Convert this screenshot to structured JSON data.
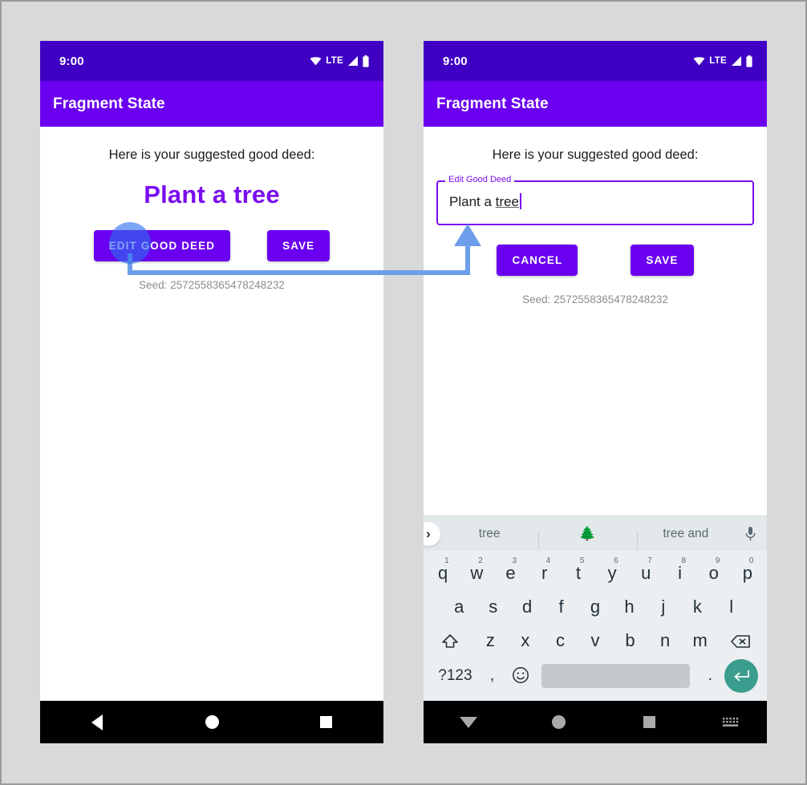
{
  "background_color": "#d9d9d9",
  "accent_purple": "#6a00ef",
  "annotation_color": "#6d9eeb",
  "phones": [
    {
      "id": "left",
      "status_bar": {
        "clock": "9:00",
        "network_label": "LTE",
        "icons": [
          "wifi-icon",
          "signal-icon",
          "battery-icon"
        ]
      },
      "app_bar": {
        "title": "Fragment State"
      },
      "content": {
        "prompt": "Here is your suggested good deed:",
        "deed_text": "Plant a tree",
        "buttons": [
          {
            "label": "EDIT GOOD DEED",
            "name": "edit-good-deed-button"
          },
          {
            "label": "SAVE",
            "name": "save-button"
          }
        ],
        "seed": "Seed: 2572558365478248232"
      },
      "nav_bar": {
        "back": "back-triangle-icon",
        "home": "home-circle-icon",
        "recents": "recents-square-icon"
      }
    },
    {
      "id": "right",
      "status_bar": {
        "clock": "9:00",
        "network_label": "LTE",
        "icons": [
          "wifi-icon",
          "signal-icon",
          "battery-icon"
        ]
      },
      "app_bar": {
        "title": "Fragment State"
      },
      "content": {
        "prompt": "Here is your suggested good deed:",
        "text_field": {
          "label": "Edit Good Deed",
          "value_prefix": "Plant a ",
          "value_underlined": "tree"
        },
        "buttons": [
          {
            "label": "CANCEL",
            "name": "cancel-button"
          },
          {
            "label": "SAVE",
            "name": "save-button"
          }
        ],
        "seed": "Seed: 2572558365478248232"
      },
      "keyboard": {
        "suggestions": {
          "expand_icon": "chevron-right-icon",
          "items": [
            "tree",
            "🌲",
            "tree and"
          ],
          "mic_icon": "microphone-icon"
        },
        "row1": [
          {
            "key": "q",
            "num": "1"
          },
          {
            "key": "w",
            "num": "2"
          },
          {
            "key": "e",
            "num": "3"
          },
          {
            "key": "r",
            "num": "4"
          },
          {
            "key": "t",
            "num": "5"
          },
          {
            "key": "y",
            "num": "6"
          },
          {
            "key": "u",
            "num": "7"
          },
          {
            "key": "i",
            "num": "8"
          },
          {
            "key": "o",
            "num": "9"
          },
          {
            "key": "p",
            "num": "0"
          }
        ],
        "row2": [
          "a",
          "s",
          "d",
          "f",
          "g",
          "h",
          "j",
          "k",
          "l"
        ],
        "row3": [
          "z",
          "x",
          "c",
          "v",
          "b",
          "n",
          "m"
        ],
        "shift_icon": "shift-icon",
        "backspace_icon": "backspace-icon",
        "bottom": {
          "symbols_key": "?123",
          "comma_key": ",",
          "emoji_key": "emoji-icon",
          "space_key": "spacebar",
          "period_key": ".",
          "enter_key": "enter-icon"
        }
      },
      "nav_bar": {
        "back": "dismiss-keyboard-triangle-icon",
        "home": "home-circle-icon",
        "recents": "recents-square-icon",
        "keyboard": "keyboard-switch-icon"
      }
    }
  ]
}
